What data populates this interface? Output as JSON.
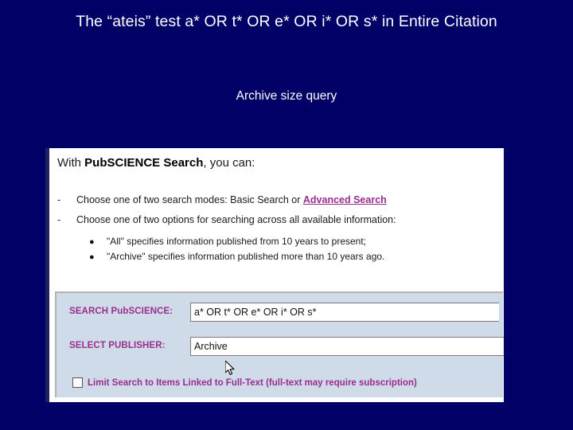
{
  "slide": {
    "background_color": "#000066",
    "title": "The “ateis” test   a* OR t* OR e* OR i*  OR s* in Entire Citation",
    "subtitle": "Archive size query"
  },
  "screenshot": {
    "intro": {
      "prefix": "With ",
      "brand": "PubSCIENCE Search",
      "suffix": ", you can:"
    },
    "dash_items": [
      {
        "dash": "-",
        "text_before": "Choose one of two search modes: Basic Search or ",
        "link": "Advanced Search",
        "text_after": ""
      },
      {
        "dash": "-",
        "text_before": "Choose one of two options for searching across all available information:",
        "link": "",
        "text_after": ""
      }
    ],
    "bullet_items": [
      {
        "dot": "●",
        "text": "\"All\" specifies information published from 10 years to present;"
      },
      {
        "dot": "●",
        "text": "\"Archive\" specifies information published more than 10 years ago."
      }
    ],
    "form": {
      "search_label": "SEARCH PubSCIENCE:",
      "search_value": "a* OR t* OR e* OR i* OR s*",
      "search_placeholder": "",
      "publisher_label": "SELECT PUBLISHER:",
      "publisher_value": "Archive",
      "publisher_placeholder": "",
      "checkbox_label": "Limit Search to Items Linked to Full-Text (full-text may require subscription)",
      "checkbox_checked": false,
      "accent_color": "#9b2d8e",
      "panel_color": "#cfdbe8"
    }
  }
}
